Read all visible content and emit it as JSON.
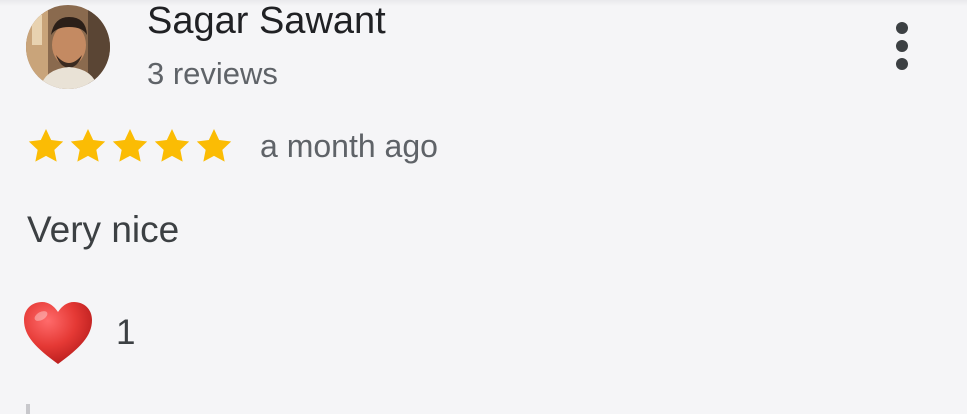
{
  "reviewer": {
    "name": "Sagar Sawant",
    "reviews_count_text": "3 reviews",
    "avatar_icon": "user-photo-avatar"
  },
  "rating": {
    "stars": 5,
    "max_stars": 5,
    "star_color": "#fbbc04",
    "time_text": "a month ago"
  },
  "review": {
    "text": "Very nice"
  },
  "reaction": {
    "icon": "red-heart-icon",
    "count": "1"
  },
  "menu": {
    "icon": "more-vertical-icon"
  },
  "colors": {
    "background": "#f5f5f7",
    "primary_text": "#202124",
    "secondary_text": "#5f6368",
    "heart": "#e53935"
  }
}
